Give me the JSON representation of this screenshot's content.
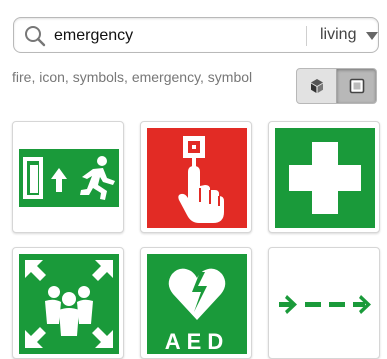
{
  "search": {
    "query": "emergency",
    "scope": "living",
    "icons": {
      "search": "search-icon",
      "dropdown": "chevron-down-icon"
    }
  },
  "tags_text": "fire, icon, symbols, emergency, symbol",
  "view_toggle": {
    "options": [
      "3d-cube-icon",
      "flat-square-icon"
    ],
    "selected": "flat-square-icon"
  },
  "results": [
    {
      "name": "emergency-exit-icon"
    },
    {
      "name": "fire-alarm-button-icon"
    },
    {
      "name": "first-aid-cross-icon"
    },
    {
      "name": "assembly-point-icon",
      "text": ""
    },
    {
      "name": "aed-defibrillator-icon",
      "text": "AED"
    },
    {
      "name": "direction-arrow-icon"
    }
  ],
  "colors": {
    "safety_green": "#1a9a3a",
    "fire_red": "#e22b25",
    "accent_bg": "#e2e2e2"
  }
}
